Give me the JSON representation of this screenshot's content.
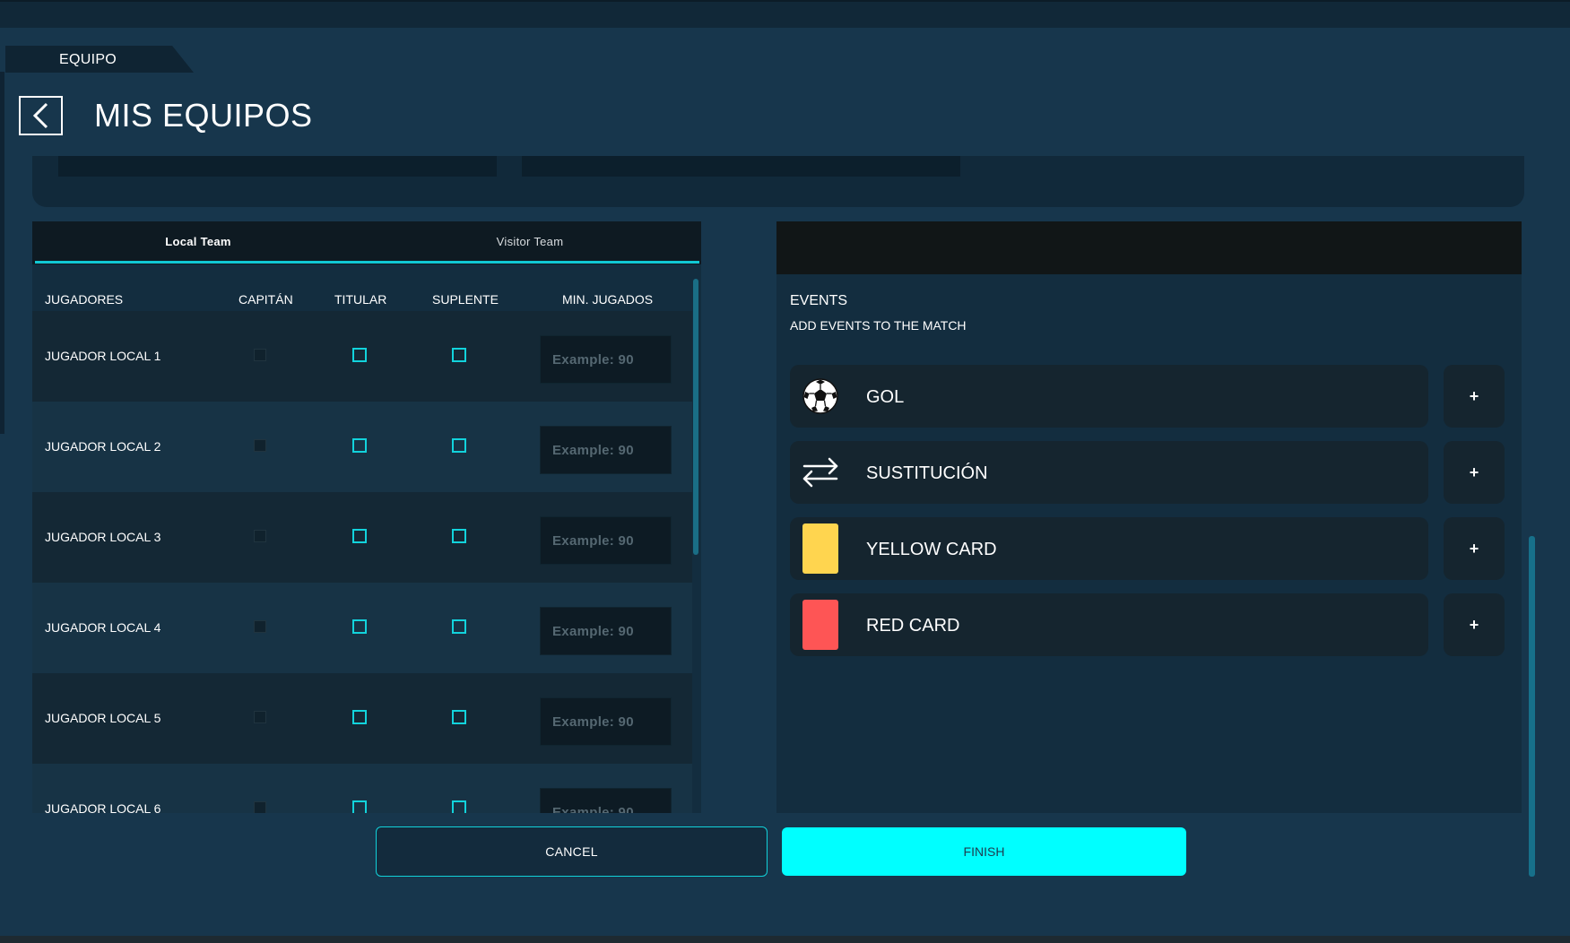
{
  "header": {
    "section_tab": "EQUIPO",
    "title": "MIS EQUIPOS"
  },
  "team_tabs": [
    {
      "label": "Local Team",
      "active": true
    },
    {
      "label": "Visitor Team",
      "active": false
    }
  ],
  "columns": {
    "players": "JUGADORES",
    "captain": "CAPITÁN",
    "starter": "TITULAR",
    "substitute": "SUPLENTE",
    "minutes": "MIN. JUGADOS"
  },
  "players": [
    {
      "name": "JUGADOR LOCAL 1",
      "placeholder": "Example: 90"
    },
    {
      "name": "JUGADOR LOCAL 2",
      "placeholder": "Example: 90"
    },
    {
      "name": "JUGADOR LOCAL 3",
      "placeholder": "Example: 90"
    },
    {
      "name": "JUGADOR LOCAL 4",
      "placeholder": "Example: 90"
    },
    {
      "name": "JUGADOR LOCAL 5",
      "placeholder": "Example: 90"
    },
    {
      "name": "JUGADOR LOCAL 6",
      "placeholder": "Example: 90"
    }
  ],
  "events": {
    "title": "EVENTS",
    "subtitle": "ADD EVENTS TO THE MATCH",
    "items": [
      {
        "label": "GOL",
        "icon": "soccer-ball-icon",
        "add_label": "+"
      },
      {
        "label": "SUSTITUCIÓN",
        "icon": "swap-arrows-icon",
        "add_label": "+"
      },
      {
        "label": "YELLOW CARD",
        "icon": "yellow-card-icon",
        "color": "#ffd54f",
        "add_label": "+"
      },
      {
        "label": "RED CARD",
        "icon": "red-card-icon",
        "color": "#fe5555",
        "add_label": "+"
      }
    ]
  },
  "actions": {
    "cancel": "CANCEL",
    "finish": "FINISH"
  },
  "colors": {
    "accent": "#00ffff",
    "checkbox_border": "#12d3dc",
    "background": "#17364c"
  }
}
